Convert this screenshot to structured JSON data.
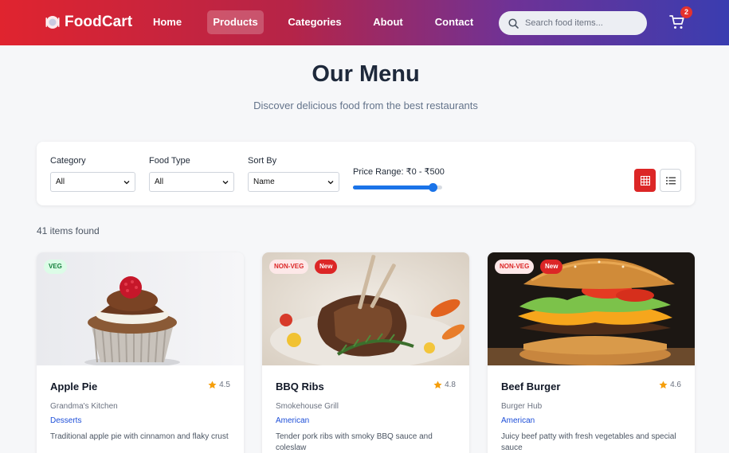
{
  "nav": {
    "brand": "FoodCart",
    "links": [
      {
        "label": "Home"
      },
      {
        "label": "Products",
        "active": true
      },
      {
        "label": "Categories"
      },
      {
        "label": "About"
      },
      {
        "label": "Contact"
      }
    ],
    "search_placeholder": "Search food items...",
    "cart_count": "2",
    "icons": {
      "brand": "plate-icon",
      "search": "search-icon",
      "cart": "cart-icon"
    }
  },
  "header": {
    "title": "Our Menu",
    "subtitle": "Discover delicious food from the best restaurants"
  },
  "filters": {
    "category": {
      "label": "Category",
      "value": "All"
    },
    "food_type": {
      "label": "Food Type",
      "value": "All"
    },
    "sort_by": {
      "label": "Sort By",
      "value": "Name"
    },
    "price_range": {
      "label": "Price Range: ₹0 - ₹500",
      "min": 0,
      "max": 500,
      "value": 500,
      "slider_fraction": 0.9
    },
    "view_modes": {
      "grid_icon": "grid-icon",
      "list_icon": "list-icon",
      "active": "grid"
    }
  },
  "results": {
    "count_text": "41 items found"
  },
  "products": [
    {
      "badges": [
        "VEG"
      ],
      "title": "Apple Pie",
      "rating": "4.5",
      "restaurant": "Grandma's Kitchen",
      "category": "Desserts",
      "description": "Traditional apple pie with cinnamon and flaky crust"
    },
    {
      "badges": [
        "NON-VEG",
        "New"
      ],
      "title": "BBQ Ribs",
      "rating": "4.8",
      "restaurant": "Smokehouse Grill",
      "category": "American",
      "description": "Tender pork ribs with smoky BBQ sauce and coleslaw"
    },
    {
      "badges": [
        "NON-VEG",
        "New"
      ],
      "title": "Beef Burger",
      "rating": "4.6",
      "restaurant": "Burger Hub",
      "category": "American",
      "description": "Juicy beef patty with fresh vegetables and special sauce"
    }
  ],
  "colors": {
    "accent": "#dc2626",
    "link": "#1d4ed8",
    "slider": "#1a73e8",
    "nav_start": "#e0242f",
    "nav_end": "#3a3db0"
  }
}
